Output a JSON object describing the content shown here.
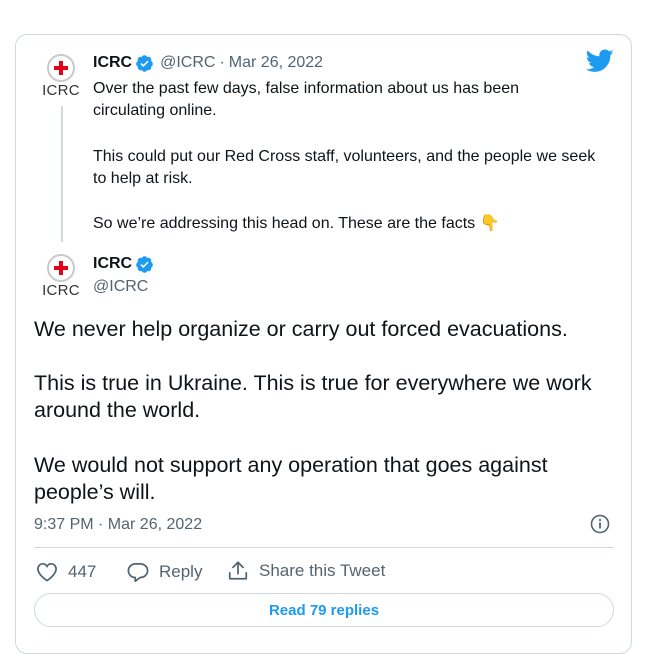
{
  "quoted_tweet": {
    "name": "ICRC",
    "handle": "@ICRC",
    "separator": "·",
    "date": "Mar 26, 2022",
    "avatar_text": "ICRC",
    "lines": [
      "Over the past few days, false information about us has been",
      "circulating online.",
      "This could put our Red Cross staff, volunteers, and the people we seek",
      "to help at risk.",
      "So we’re addressing this head on. These are the facts"
    ],
    "emoji": "👇"
  },
  "main_tweet": {
    "name": "ICRC",
    "handle": "@ICRC",
    "avatar_text": "ICRC",
    "lines": [
      "We never help organize or carry out forced evacuations.",
      "This is true in Ukraine. This is true for everywhere we work",
      "around the world.",
      "We would not support any operation that goes against",
      "people’s will."
    ],
    "timestamp": "9:37 PM · Mar 26, 2022"
  },
  "actions": {
    "like_count": "447",
    "reply_label": "Reply",
    "share_label": "Share this Tweet"
  },
  "read_replies_label": "Read 79 replies",
  "colors": {
    "twitter_blue": "#1d9bf0",
    "verified_blue": "#1d9bf0",
    "muted": "#536471",
    "border": "#cfd9de",
    "text": "#0f1419",
    "red_cross": "#e3001b"
  },
  "icons": [
    "twitter-logo-icon",
    "verified-badge-icon",
    "red-cross-emblem-icon",
    "heart-icon",
    "reply-icon",
    "share-icon",
    "info-icon"
  ]
}
